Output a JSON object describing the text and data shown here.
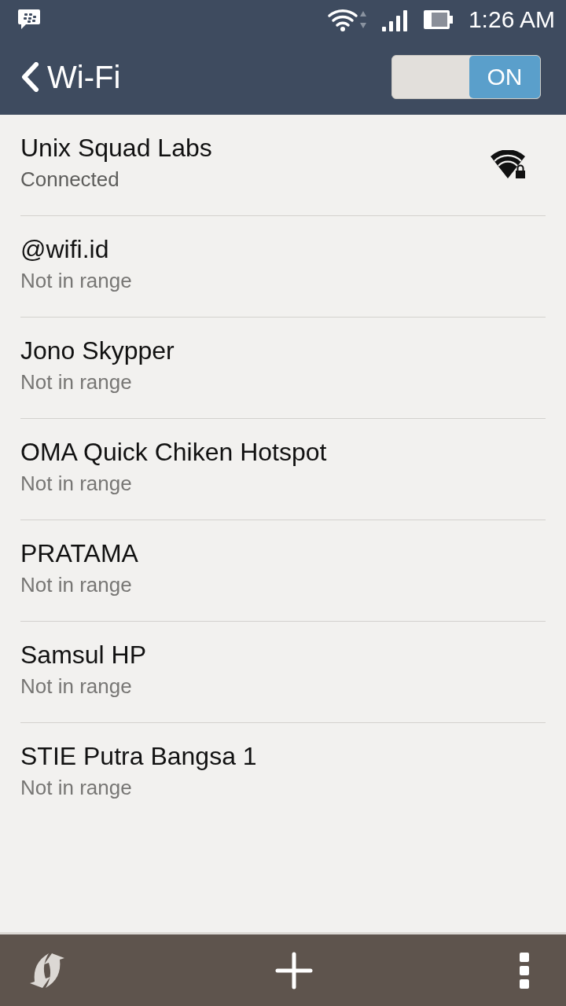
{
  "status_bar": {
    "time": "1:26 AM"
  },
  "app_bar": {
    "title": "Wi-Fi",
    "toggle": {
      "label": "ON",
      "on": true
    }
  },
  "networks": [
    {
      "name": "Unix Squad Labs",
      "status": "Connected",
      "in_range": true
    },
    {
      "name": "@wifi.id",
      "status": "Not in range",
      "in_range": false
    },
    {
      "name": "Jono Skypper",
      "status": "Not in range",
      "in_range": false
    },
    {
      "name": "OMA Quick Chiken Hotspot",
      "status": "Not in range",
      "in_range": false
    },
    {
      "name": "PRATAMA",
      "status": "Not in range",
      "in_range": false
    },
    {
      "name": "Samsul HP",
      "status": "Not in range",
      "in_range": false
    },
    {
      "name": "STIE Putra Bangsa 1",
      "status": "Not in range",
      "in_range": false
    }
  ]
}
